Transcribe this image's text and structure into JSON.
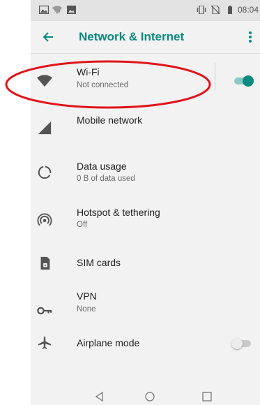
{
  "status_bar": {
    "time": "08:04",
    "icons": [
      "gallery-icon",
      "wifi-question-icon",
      "image-icon",
      "vibrate-icon",
      "no-sim-icon",
      "battery-icon"
    ]
  },
  "app_bar": {
    "back_icon": "arrow-left-icon",
    "title": "Network & Internet",
    "more_icon": "more-vert-icon"
  },
  "settings": [
    {
      "id": "wifi",
      "icon": "wifi-icon",
      "title": "Wi-Fi",
      "subtitle": "Not connected",
      "toggle": true,
      "toggle_on": true
    },
    {
      "id": "mobile",
      "icon": "cellular-signal-icon",
      "title": "Mobile network"
    },
    {
      "id": "data",
      "icon": "data-usage-icon",
      "title": "Data usage",
      "subtitle": "0 B of data used"
    },
    {
      "id": "hotspot",
      "icon": "hotspot-icon",
      "title": "Hotspot & tethering",
      "subtitle": "Off"
    },
    {
      "id": "sim",
      "icon": "sim-card-icon",
      "title": "SIM cards"
    },
    {
      "id": "vpn",
      "icon": "vpn-key-icon",
      "title": "VPN",
      "subtitle": "None"
    },
    {
      "id": "airplane",
      "icon": "airplane-icon",
      "title": "Airplane mode",
      "toggle": true,
      "toggle_on": false
    }
  ],
  "nav_bar": {
    "back_icon": "nav-back-icon",
    "home_icon": "nav-home-icon",
    "recents_icon": "nav-recents-icon"
  },
  "colors": {
    "accent": "#0b8a80",
    "annotation": "#e0141b",
    "toggle_off": "#bdbdbd"
  }
}
